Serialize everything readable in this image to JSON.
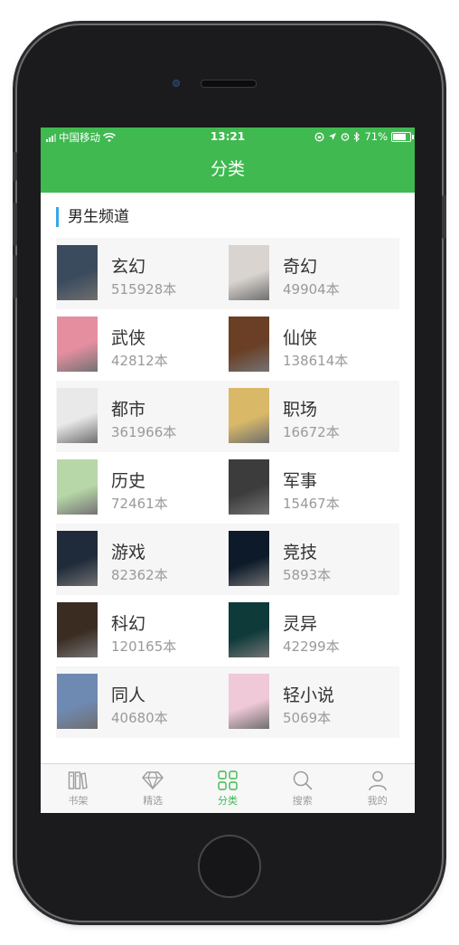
{
  "status_bar": {
    "carrier": "中国移动",
    "time": "13:21",
    "battery": "71%"
  },
  "nav": {
    "title": "分类"
  },
  "section": {
    "title": "男生频道"
  },
  "categories": [
    {
      "name": "玄幻",
      "count": "515928本",
      "cover_color": "#3b4b5e"
    },
    {
      "name": "奇幻",
      "count": "49904本",
      "cover_color": "#d9d4cf"
    },
    {
      "name": "武侠",
      "count": "42812本",
      "cover_color": "#e58ea0"
    },
    {
      "name": "仙侠",
      "count": "138614本",
      "cover_color": "#6a3f26"
    },
    {
      "name": "都市",
      "count": "361966本",
      "cover_color": "#e9e9e9"
    },
    {
      "name": "职场",
      "count": "16672本",
      "cover_color": "#d9b968"
    },
    {
      "name": "历史",
      "count": "72461本",
      "cover_color": "#b8d7a8"
    },
    {
      "name": "军事",
      "count": "15467本",
      "cover_color": "#3c3c3c"
    },
    {
      "name": "游戏",
      "count": "82362本",
      "cover_color": "#1f2b3a"
    },
    {
      "name": "竞技",
      "count": "5893本",
      "cover_color": "#0d1a2a"
    },
    {
      "name": "科幻",
      "count": "120165本",
      "cover_color": "#3b2c22"
    },
    {
      "name": "灵异",
      "count": "42299本",
      "cover_color": "#0f3a3a"
    },
    {
      "name": "同人",
      "count": "40680本",
      "cover_color": "#6f8ab2"
    },
    {
      "name": "轻小说",
      "count": "5069本",
      "cover_color": "#f0c9d8"
    }
  ],
  "tabs": [
    {
      "label": "书架",
      "icon": "bookshelf-icon",
      "active": false
    },
    {
      "label": "精选",
      "icon": "diamond-icon",
      "active": false
    },
    {
      "label": "分类",
      "icon": "category-grid-icon",
      "active": true
    },
    {
      "label": "搜索",
      "icon": "search-icon",
      "active": false
    },
    {
      "label": "我的",
      "icon": "person-icon",
      "active": false
    }
  ],
  "colors": {
    "accent": "#3fb950",
    "section_bar": "#39a6e8"
  }
}
